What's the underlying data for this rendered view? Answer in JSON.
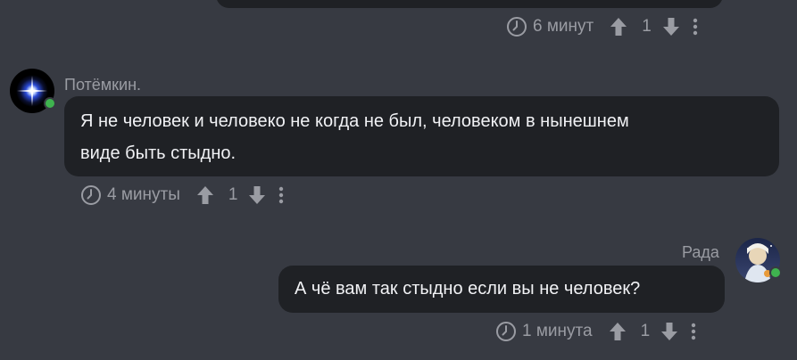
{
  "thread": {
    "top_meta": {
      "time": "6 минут",
      "votes": "1"
    },
    "messages": [
      {
        "author": "Потёмкин.",
        "text_line1": "Я не человек и человеко не когда не был, человеком в нынешнем",
        "text_line2": "виде быть стыдно.",
        "time": "4 минуты",
        "votes": "1",
        "online": true
      },
      {
        "author": "Рада",
        "text": "А чё вам так стыдно если вы не человек?",
        "time": "1 минута",
        "votes": "1",
        "online": true
      }
    ]
  },
  "colors": {
    "background": "#373a42",
    "bubble": "#1f2125",
    "muted_text": "#9a9ca3",
    "online": "#3fb34f"
  },
  "icons": [
    "clock-icon",
    "upvote-arrow-icon",
    "downvote-arrow-icon",
    "more-vertical-icon"
  ]
}
